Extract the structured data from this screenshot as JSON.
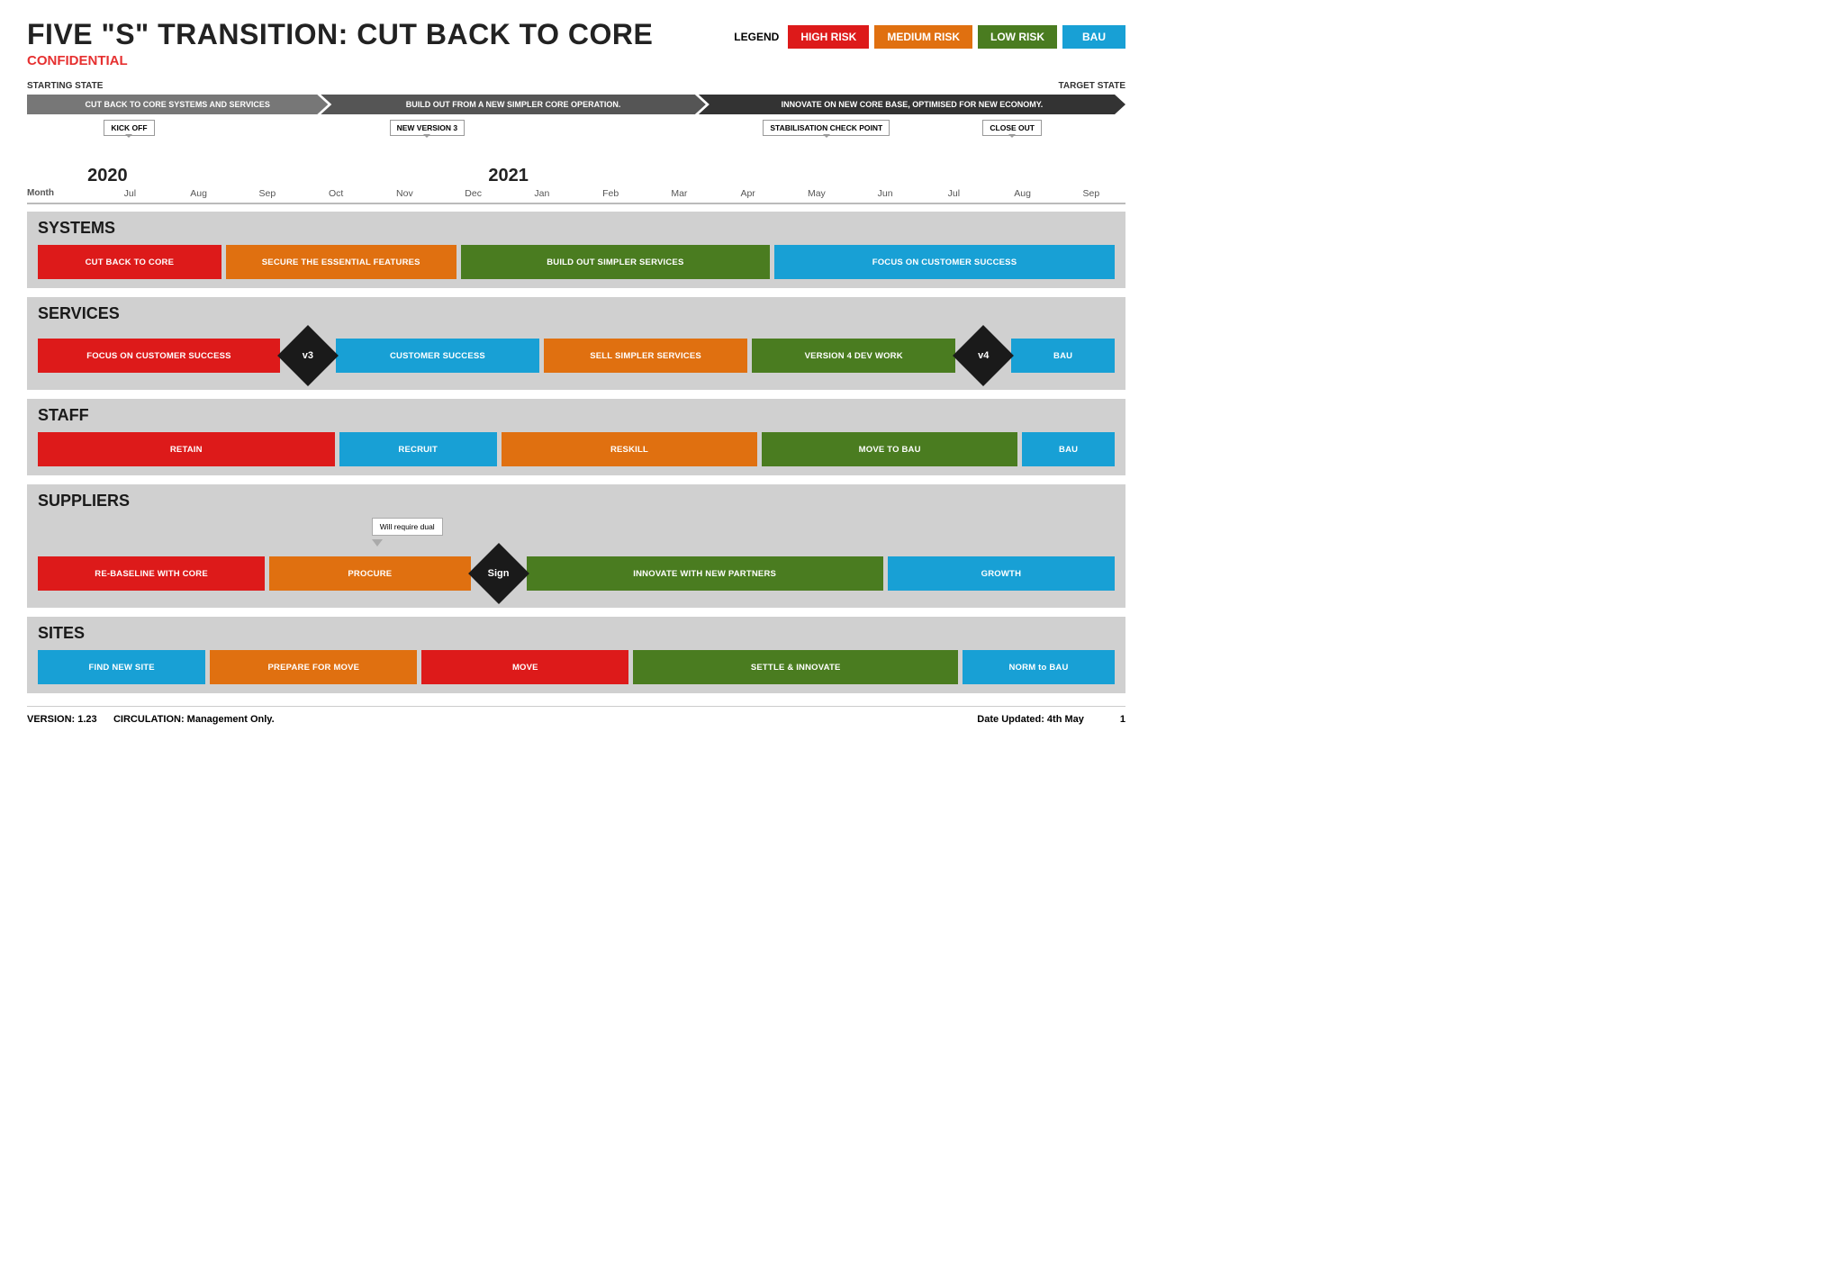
{
  "header": {
    "title": "FIVE \"S\" TRANSITION: CUT BACK TO CORE",
    "confidential": "CONFIDENTIAL",
    "legend_label": "LEGEND",
    "legend": [
      {
        "label": "HIGH RISK",
        "color": "#dd1a1a"
      },
      {
        "label": "MEDIUM RISK",
        "color": "#e07010"
      },
      {
        "label": "LOW RISK",
        "color": "#4a7c20"
      },
      {
        "label": "BAU",
        "color": "#18a0d5"
      }
    ]
  },
  "timeline": {
    "starting_state": "STARTING STATE",
    "target_state": "TARGET STATE",
    "phases": [
      {
        "label": "CUT BACK TO CORE SYSTEMS AND SERVICES",
        "color": "gray"
      },
      {
        "label": "BUILD OUT FROM A NEW SIMPLER CORE OPERATION.",
        "color": "mid-gray"
      },
      {
        "label": "INNOVATE ON NEW CORE BASE, OPTIMISED FOR NEW ECONOMY.",
        "color": "dark-gray"
      }
    ],
    "callouts": [
      {
        "label": "KICK OFF",
        "position": "left"
      },
      {
        "label": "NEW VERSION 3",
        "position": "center-left"
      },
      {
        "label": "STABILISATION CHECK POINT",
        "position": "center-right"
      },
      {
        "label": "CLOSE OUT",
        "position": "right"
      }
    ],
    "years": [
      "2020",
      "2021"
    ],
    "months": [
      "Month",
      "Jul",
      "Aug",
      "Sep",
      "Oct",
      "Nov",
      "Dec",
      "Jan",
      "Feb",
      "Mar",
      "Apr",
      "May",
      "Jun",
      "Jul",
      "Aug",
      "Sep"
    ]
  },
  "sections": {
    "systems": {
      "name": "SYSTEMS",
      "bars": [
        {
          "label": "CUT BACK TO CORE",
          "color": "red",
          "flex": 2.2
        },
        {
          "label": "SECURE THE ESSENTIAL FEATURES",
          "color": "orange",
          "flex": 2.8
        },
        {
          "label": "BUILD OUT SIMPLER SERVICES",
          "color": "green",
          "flex": 3.8
        },
        {
          "label": "FOCUS ON CUSTOMER SUCCESS",
          "color": "blue",
          "flex": 4.2
        }
      ]
    },
    "services": {
      "name": "SERVICES",
      "bars": [
        {
          "label": "FOCUS ON CUSTOMER SUCCESS",
          "color": "red",
          "flex": 3
        },
        {
          "label": "v3",
          "type": "diamond"
        },
        {
          "label": "CUSTOMER SUCCESS",
          "color": "blue",
          "flex": 2.5
        },
        {
          "label": "SELL SIMPLER SERVICES",
          "color": "orange",
          "flex": 2.5
        },
        {
          "label": "VERSION 4 DEV WORK",
          "color": "green",
          "flex": 2.5
        },
        {
          "label": "v4",
          "type": "diamond"
        },
        {
          "label": "BAU",
          "color": "blue",
          "flex": 1.2
        }
      ]
    },
    "staff": {
      "name": "STAFF",
      "bars": [
        {
          "label": "RETAIN",
          "color": "red",
          "flex": 3.5
        },
        {
          "label": "RECRUIT",
          "color": "blue",
          "flex": 1.8
        },
        {
          "label": "RESKILL",
          "color": "orange",
          "flex": 3
        },
        {
          "label": "MOVE TO BAU",
          "color": "green",
          "flex": 3
        },
        {
          "label": "BAU",
          "color": "blue",
          "flex": 1
        }
      ]
    },
    "suppliers": {
      "name": "SUPPLIERS",
      "bars": [
        {
          "label": "RE-BASELINE WITH CORE",
          "color": "red",
          "flex": 2.5
        },
        {
          "label": "PROCURE",
          "color": "orange",
          "flex": 2.2
        },
        {
          "label": "Sign",
          "type": "diamond"
        },
        {
          "label": "INNOVATE WITH NEW PARTNERS",
          "color": "green",
          "flex": 4
        },
        {
          "label": "GROWTH",
          "color": "blue",
          "flex": 2.5
        }
      ],
      "tooltip": "Will require dual"
    },
    "sites": {
      "name": "SITES",
      "bars": [
        {
          "label": "FIND NEW SITE",
          "color": "blue",
          "flex": 2
        },
        {
          "label": "PREPARE FOR MOVE",
          "color": "orange",
          "flex": 2.5
        },
        {
          "label": "MOVE",
          "color": "red",
          "flex": 2.5
        },
        {
          "label": "SETTLE & INNOVATE",
          "color": "green",
          "flex": 4
        },
        {
          "label": "NORM to BAU",
          "color": "blue",
          "flex": 1.8
        }
      ]
    }
  },
  "footer": {
    "version": "VERSION: 1.23",
    "circulation": "CIRCULATION: Management Only.",
    "date_updated": "Date Updated: 4th May",
    "page": "1"
  }
}
